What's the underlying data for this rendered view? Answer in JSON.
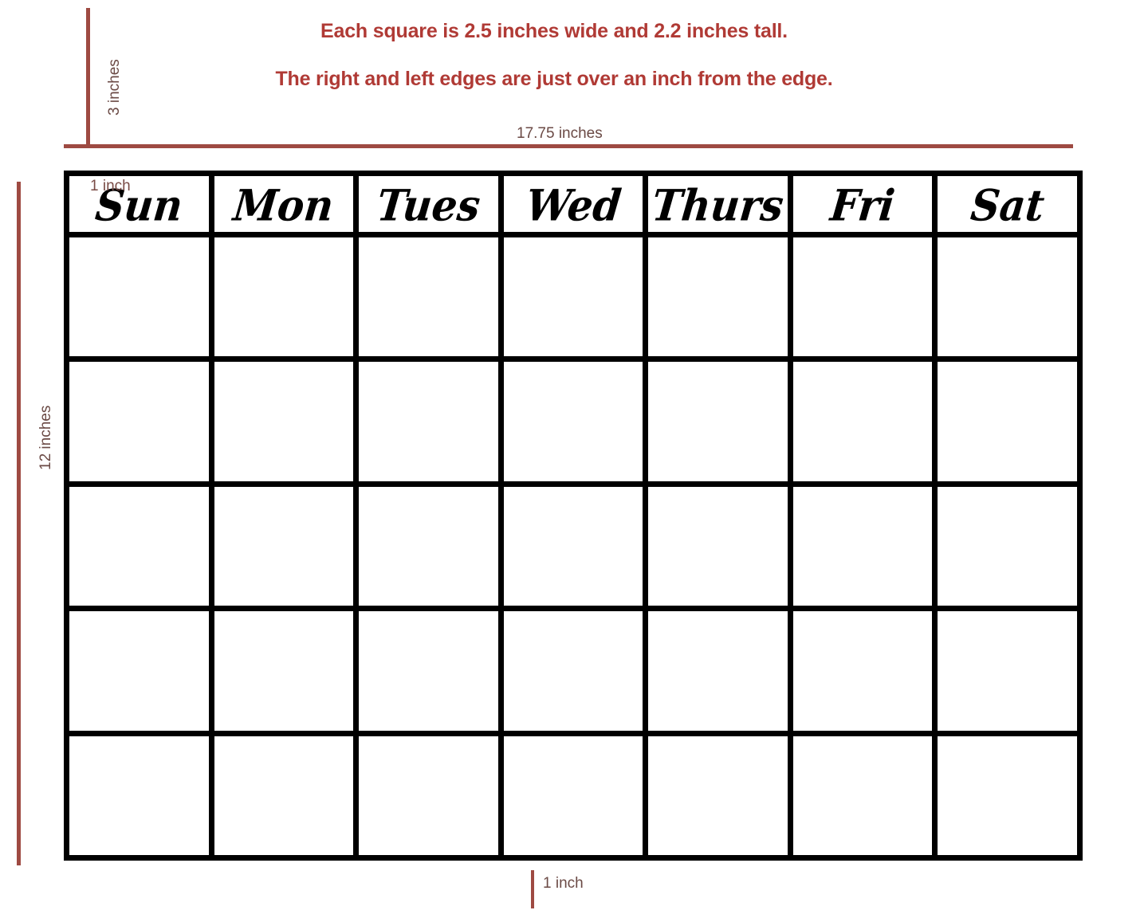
{
  "notes": {
    "squares": "Each square is 2.5 inches wide and 2.2 inches tall.",
    "edges": "The right and left edges are just over an inch from the edge."
  },
  "dimensions": {
    "top_margin": "3 inches",
    "total_width": "17.75 inches",
    "total_height": "12 inches",
    "left_margin": "1 inch",
    "bottom_margin": "1 inch"
  },
  "colors": {
    "note_red": "#b03a35",
    "rule_red": "#9e4a42",
    "label_brown": "#6b4a45",
    "grid_line": "#000000",
    "cell_fill": "#ffffff",
    "page_background": "#ffffff"
  },
  "calendar": {
    "day_headers": [
      "Sun",
      "Mon",
      "Tues",
      "Wed",
      "Thurs",
      "Fri",
      "Sat"
    ],
    "week_rows": 5,
    "columns": 7,
    "cells": [
      [
        "",
        "",
        "",
        "",
        "",
        "",
        ""
      ],
      [
        "",
        "",
        "",
        "",
        "",
        "",
        ""
      ],
      [
        "",
        "",
        "",
        "",
        "",
        "",
        ""
      ],
      [
        "",
        "",
        "",
        "",
        "",
        "",
        ""
      ],
      [
        "",
        "",
        "",
        "",
        "",
        "",
        ""
      ]
    ]
  }
}
